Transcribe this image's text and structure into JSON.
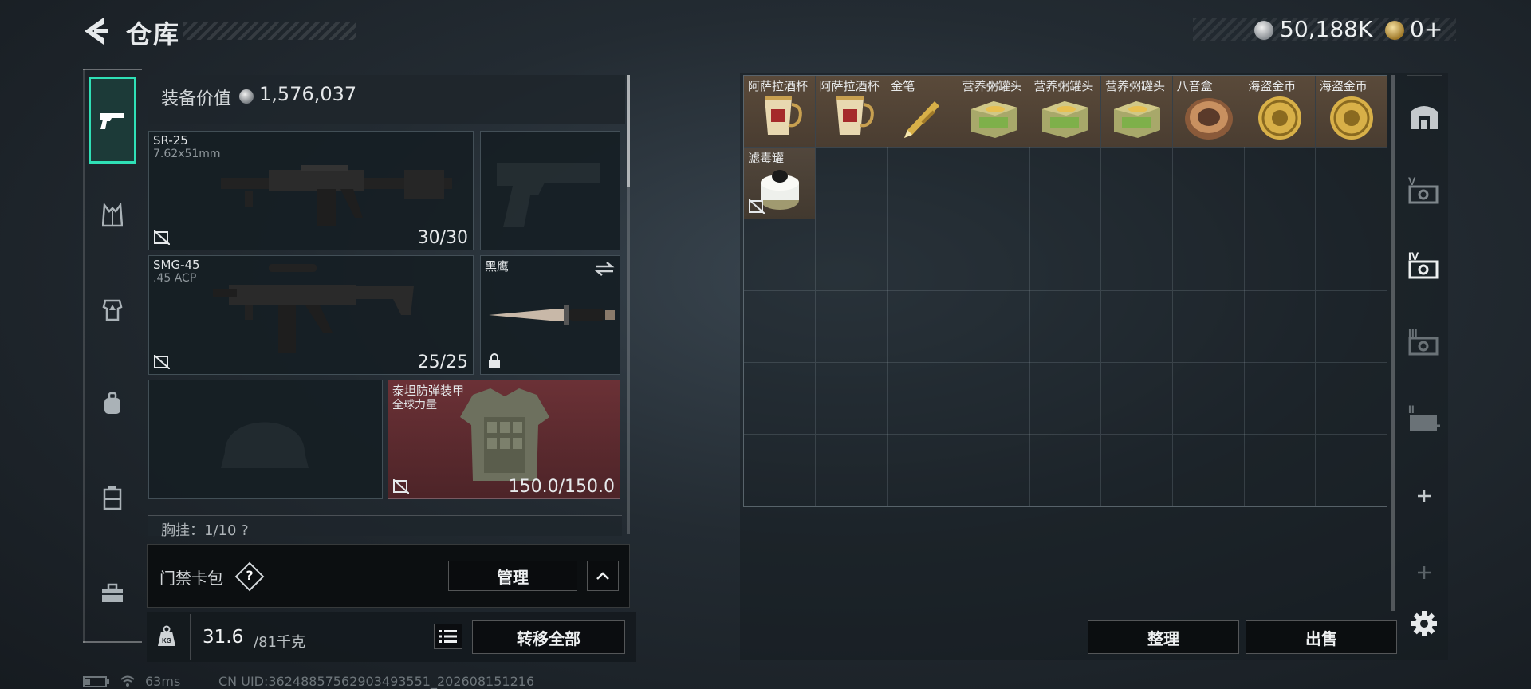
{
  "header": {
    "title": "仓库",
    "money": "50,188K",
    "premium": "0+"
  },
  "sidebar": {
    "items": [
      {
        "name": "weapons",
        "active": true
      },
      {
        "name": "armor"
      },
      {
        "name": "chest-rig"
      },
      {
        "name": "backpack"
      },
      {
        "name": "pouch"
      },
      {
        "name": "toolbox"
      }
    ]
  },
  "equipment": {
    "value_label": "装备价值",
    "value": "1,576,037",
    "primary": {
      "name": "SR-25",
      "caliber": "7.62x51mm",
      "ammo": "30/30"
    },
    "secondary": {
      "name": "SMG-45",
      "caliber": ".45 ACP",
      "ammo": "25/25"
    },
    "melee": {
      "name": "黑鹰"
    },
    "armor": {
      "name": "泰坦防弹装甲",
      "subtitle": "全球力量",
      "durability": "150.0/150.0"
    },
    "pouch_text": "胸挂：1/10  ?"
  },
  "keycard": {
    "label": "门禁卡包",
    "help": "?",
    "manage_label": "管理"
  },
  "weight": {
    "current": "31.6",
    "max": "/81千克",
    "transfer_label": "转移全部"
  },
  "status": {
    "ping": "63ms",
    "uid": "CN UID:3624885756290349355​1_202608151216"
  },
  "storage": {
    "items": [
      {
        "name": "阿萨拉酒杯",
        "art": "cup"
      },
      {
        "name": "阿萨拉酒杯",
        "art": "cup"
      },
      {
        "name": "金笔",
        "art": "pen"
      },
      {
        "name": "营养粥罐头",
        "art": "can"
      },
      {
        "name": "营养粥罐头",
        "art": "can"
      },
      {
        "name": "营养粥罐头",
        "art": "can"
      },
      {
        "name": "八音盒",
        "art": "musicbox"
      },
      {
        "name": "海盗金币",
        "art": "coin"
      },
      {
        "name": "海盗金币",
        "art": "coin"
      },
      {
        "name": "滤毒罐",
        "art": "filter"
      }
    ],
    "sort_label": "整理",
    "sell_label": "出售"
  },
  "colors": {
    "accent": "#2fe0b6",
    "item_bg": "#5a4a3a",
    "armor_bg": "#6b3136"
  }
}
